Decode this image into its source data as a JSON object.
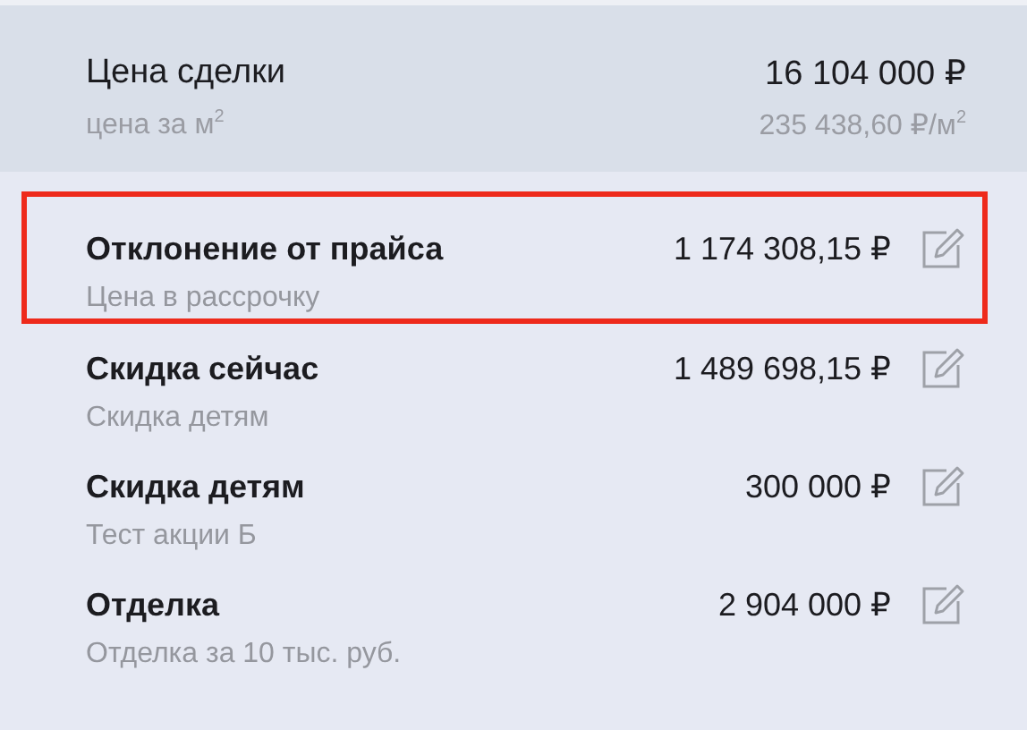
{
  "summary": {
    "label": "Цена сделки",
    "value": "16 104 000 ₽",
    "sublabel": "цена за м$^{2}$",
    "subvalue": "235 438,60 ₽/м$^{2}$"
  },
  "items": [
    {
      "title": "Отклонение от прайса",
      "amount": "1 174 308,15 ₽",
      "subtitle": "Цена в рассрочку",
      "highlighted": true
    },
    {
      "title": "Скидка сейчас",
      "amount": "1 489 698,15 ₽",
      "subtitle": "Скидка детям",
      "highlighted": false
    },
    {
      "title": "Скидка детям",
      "amount": "300 000 ₽",
      "subtitle": "Тест акции Б",
      "highlighted": false
    },
    {
      "title": "Отделка",
      "amount": "2 904 000 ₽",
      "subtitle": "Отделка за 10 тыс. руб.",
      "highlighted": false
    }
  ]
}
